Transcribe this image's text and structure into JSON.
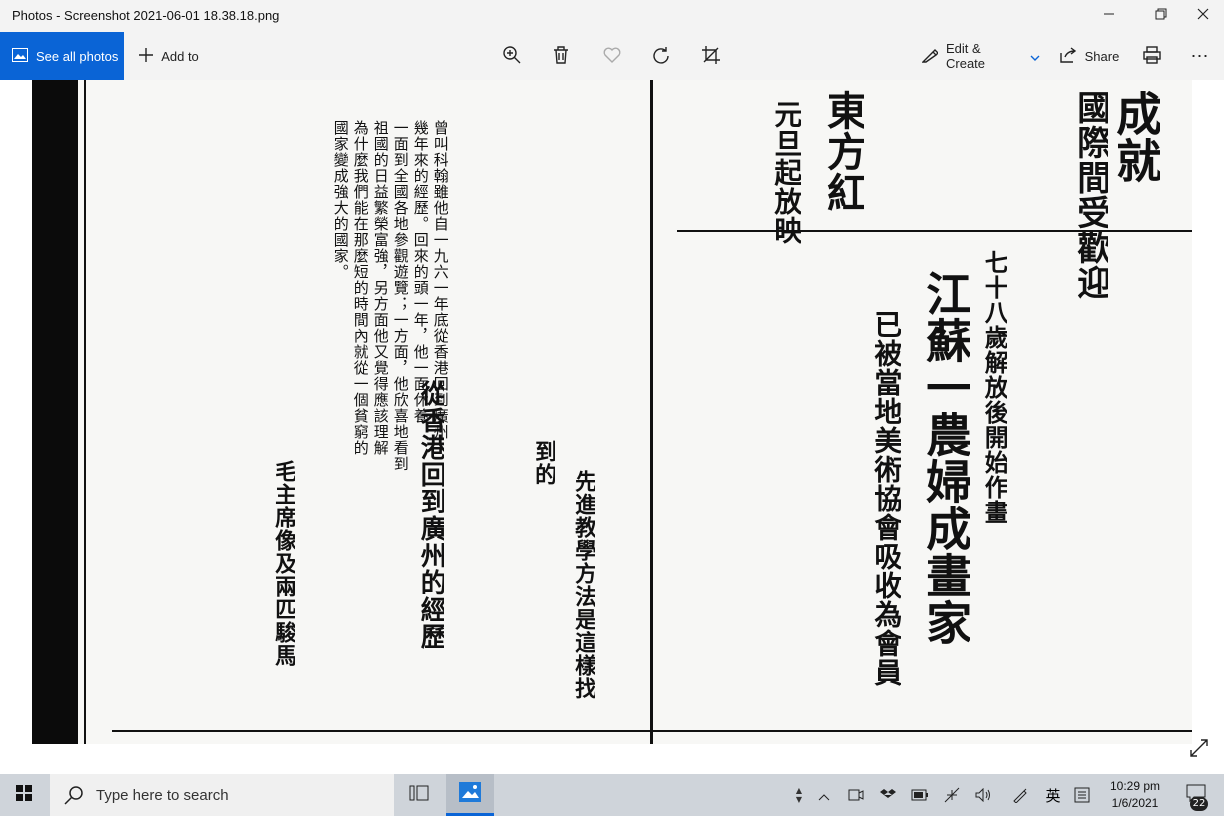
{
  "window": {
    "title": "Photos - Screenshot 2021-06-01 18.38.18.png",
    "minimize_icon": "minimize-icon",
    "maximize_icon": "restore-icon",
    "close_icon": "close-icon"
  },
  "toolbar": {
    "see_all_label": "See all photos",
    "add_to_label": "Add to",
    "edit_create_label": "Edit & Create",
    "share_label": "Share",
    "accent": "#0a64d6"
  },
  "photo": {
    "columns": [
      {
        "text": "曾叫科翰雖他自一九六一年底從香港回到廣州",
        "kind": "body"
      },
      {
        "text": "幾年來的經歷。回來的頭一年，他一面休養",
        "kind": "body"
      },
      {
        "text": "一面到全國各地參觀遊覽；一方面，他欣喜地看到",
        "kind": "body"
      },
      {
        "text": "祖國的日益繁榮富強，另方面他又覺得應該理解",
        "kind": "body"
      },
      {
        "text": "為什麼我們能在那麼短的時間內就從一個貧窮的",
        "kind": "body"
      },
      {
        "text": "國家變成強大的國家。",
        "kind": "body"
      },
      {
        "text": "從香港回到廣州的經歷",
        "kind": "headline"
      },
      {
        "text": "先進教學方法是這樣找",
        "kind": "headline"
      },
      {
        "text": "到的",
        "kind": "headline"
      },
      {
        "text": "毛主席像及兩匹駿馬",
        "kind": "headline"
      },
      {
        "text": "七十八歲解放後開始作畫",
        "kind": "headline"
      },
      {
        "text": "江蘇一農婦成畫家",
        "kind": "headline"
      },
      {
        "text": "已被當地美術協會吸收為會員",
        "kind": "headline"
      },
      {
        "text": "東方紅",
        "kind": "headline"
      },
      {
        "text": "元旦起放映",
        "kind": "headline"
      },
      {
        "text": "國際間受歡迎",
        "kind": "headline"
      },
      {
        "text": "成就",
        "kind": "headline"
      }
    ]
  },
  "taskbar": {
    "search_placeholder": "Type here to search",
    "time": "10:29 pm",
    "date": "1/6/2021",
    "ime_label": "英",
    "notification_count": "22"
  }
}
